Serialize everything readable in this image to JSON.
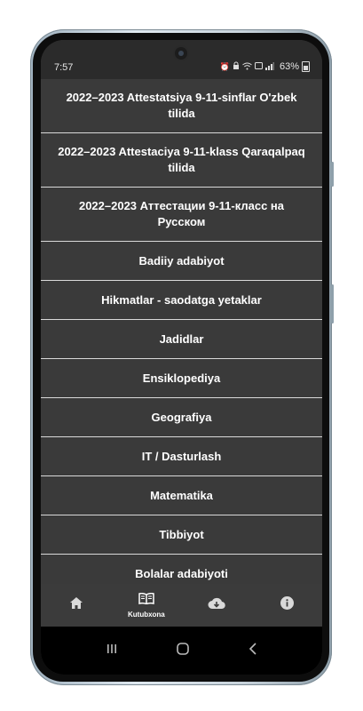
{
  "status_bar": {
    "time": "7:57",
    "battery": "63%"
  },
  "library": {
    "items": [
      {
        "label": "2022–2023 Attestatsiya 9-11-sinflar O'zbek tilida"
      },
      {
        "label": "2022–2023 Attestaciya 9-11-klass Qaraqalpaq tilida"
      },
      {
        "label": "2022–2023 Аттестации 9-11-класс на Русском"
      },
      {
        "label": "Badiiy adabiyot"
      },
      {
        "label": "Hikmatlar - saodatga yetaklar"
      },
      {
        "label": "Jadidlar"
      },
      {
        "label": "Ensiklopediya"
      },
      {
        "label": "Geografiya"
      },
      {
        "label": "IT / Dasturlash"
      },
      {
        "label": "Matematika"
      },
      {
        "label": "Tibbiyot"
      },
      {
        "label": "Bolalar adabiyoti"
      }
    ]
  },
  "bottom_nav": {
    "home_icon": "home-icon",
    "library_label": "Kutubxona",
    "library_icon": "book-icon",
    "download_icon": "cloud-download-icon",
    "info_icon": "info-icon"
  },
  "colors": {
    "list_bg": "#3a3a3a",
    "divider": "#d9d9d9",
    "statusbar_bg": "#2b2b2b",
    "nav_bg": "#3b3b3b"
  }
}
